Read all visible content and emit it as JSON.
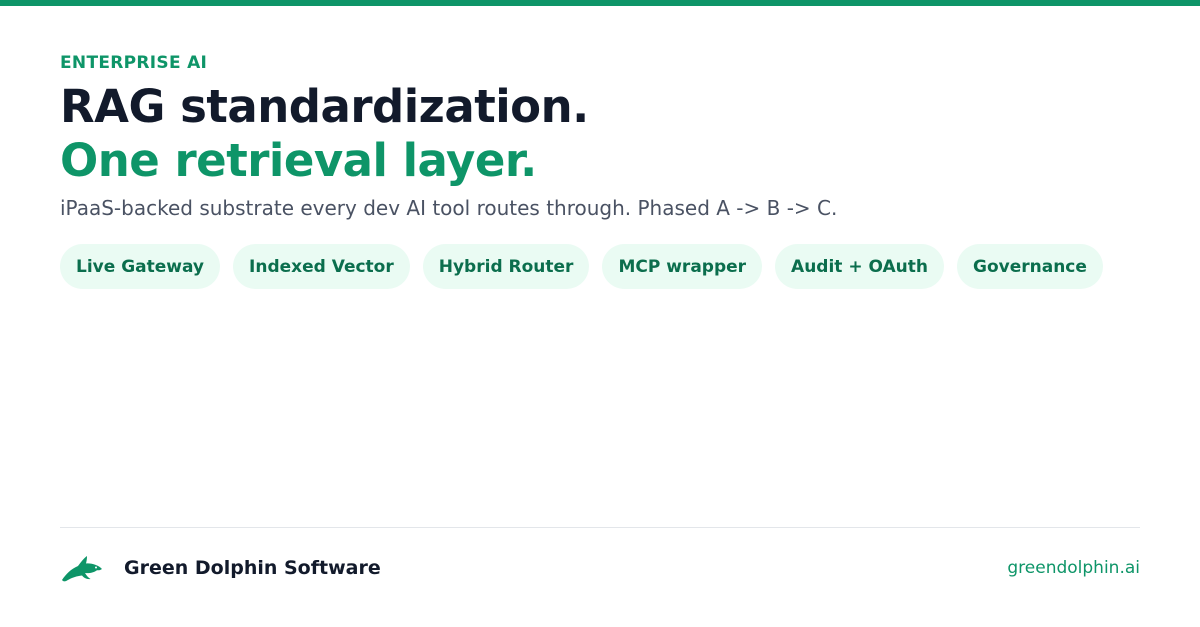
{
  "header": {
    "eyebrow": "ENTERPRISE AI",
    "headline_line1": "RAG standardization.",
    "headline_line2": "One retrieval layer.",
    "subtitle": "iPaaS-backed substrate every dev AI tool routes through. Phased A -> B -> C."
  },
  "tags": [
    "Live Gateway",
    "Indexed Vector",
    "Hybrid Router",
    "MCP wrapper",
    "Audit + OAuth",
    "Governance"
  ],
  "footer": {
    "logo_icon": "dolphin-icon",
    "company": "Green Dolphin Software",
    "website": "greendolphin.ai"
  },
  "colors": {
    "accent": "#0e9568",
    "heading": "#121a2b",
    "pill_bg": "#eafbf3",
    "pill_text": "#0b6e4d"
  }
}
